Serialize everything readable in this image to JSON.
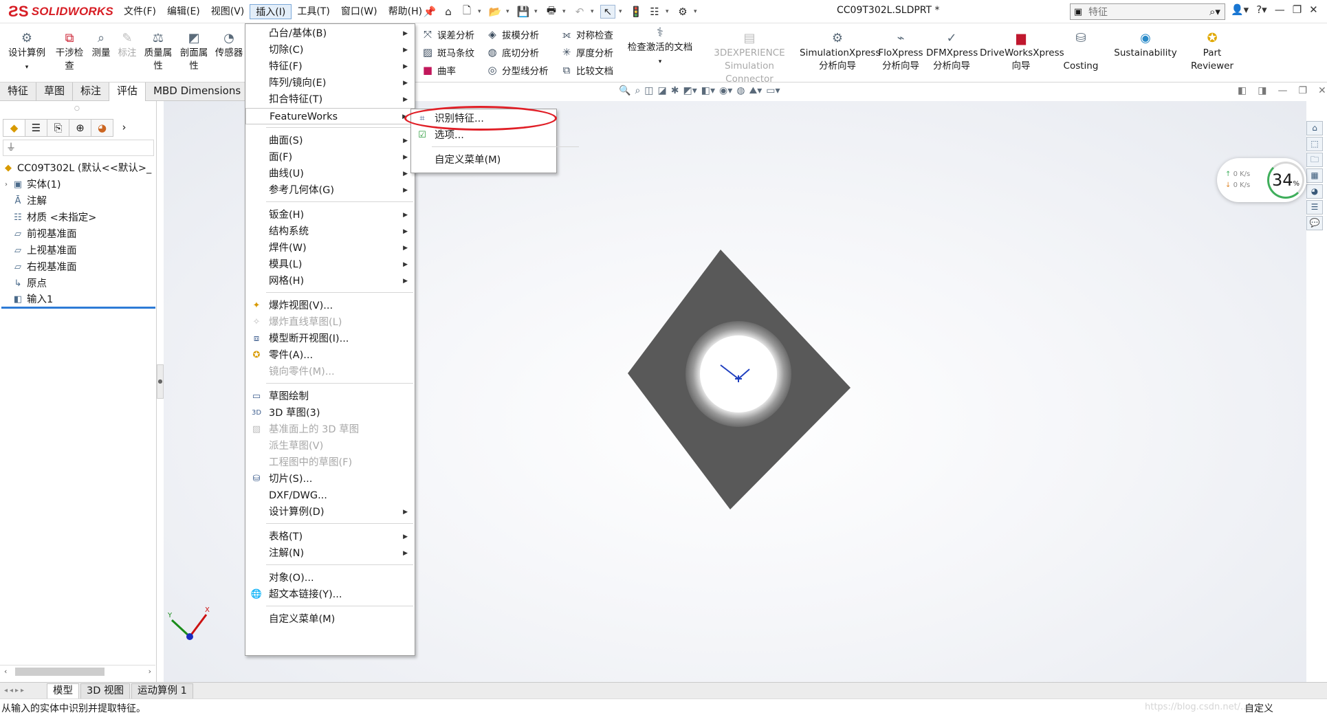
{
  "app": {
    "brand": "SOLIDWORKS",
    "brand_color": "#d71d24",
    "doc_title": "CC09T302L.SLDPRT *"
  },
  "menubar": [
    "文件(F)",
    "编辑(E)",
    "视图(V)",
    "插入(I)",
    "工具(T)",
    "窗口(W)",
    "帮助(H)"
  ],
  "search": {
    "placeholder": "特征"
  },
  "commands": {
    "design_study": "设计算例",
    "interference_a": "干涉检",
    "interference_b": "查",
    "measure": "测量",
    "markup": "标注",
    "mass_a": "质量属",
    "mass_b": "性",
    "section_a": "剖面属",
    "section_b": "性",
    "sensor": "传感器",
    "deviation": "误差分析",
    "zebra": "斑马条纹",
    "curvature": "曲率",
    "draft": "拔模分析",
    "undercut": "底切分析",
    "parting": "分型线分析",
    "symmetry": "对称检查",
    "thickness": "厚度分析",
    "compare": "比较文档",
    "check_active": "检查激活的文档",
    "xp_a": "3DEXPERIENCE",
    "xp_b": "Simulation Connector",
    "simx_a": "SimulationXpress",
    "simx_b": "分析向导",
    "flox_a": "FloXpress",
    "flox_b": "分析向导",
    "dfm_a": "DFMXpress",
    "dfm_b": "分析向导",
    "dw_a": "DriveWorksXpress",
    "dw_b": "向导",
    "costing": "Costing",
    "sustain": "Sustainability",
    "part_a": "Part",
    "part_b": "Reviewer"
  },
  "tabs": [
    "特征",
    "草图",
    "标注",
    "评估",
    "MBD Dimensions"
  ],
  "tree": {
    "root": "CC09T302L  (默认<<默认>_",
    "items": [
      "实体(1)",
      "注解",
      "材质 <未指定>",
      "前视基准面",
      "上视基准面",
      "右视基准面",
      "原点",
      "输入1"
    ]
  },
  "insert_menu": [
    {
      "label": "凸台/基体(B)",
      "sub": true
    },
    {
      "label": "切除(C)",
      "sub": true
    },
    {
      "label": "特征(F)",
      "sub": true
    },
    {
      "label": "阵列/镜向(E)",
      "sub": true
    },
    {
      "label": "扣合特征(T)",
      "sub": true
    },
    {
      "label": "FeatureWorks",
      "sub": true
    },
    {
      "label": "曲面(S)",
      "sub": true
    },
    {
      "label": "面(F)",
      "sub": true
    },
    {
      "label": "曲线(U)",
      "sub": true
    },
    {
      "label": "参考几何体(G)",
      "sub": true
    },
    {
      "label": "钣金(H)",
      "sub": true
    },
    {
      "label": "结构系统",
      "sub": true
    },
    {
      "label": "焊件(W)",
      "sub": true
    },
    {
      "label": "模具(L)",
      "sub": true
    },
    {
      "label": "网格(H)",
      "sub": true
    },
    {
      "label": "爆炸视图(V)..."
    },
    {
      "label": "爆炸直线草图(L)"
    },
    {
      "label": "模型断开视图(I)..."
    },
    {
      "label": "零件(A)..."
    },
    {
      "label": "镜向零件(M)..."
    },
    {
      "label": "草图绘制"
    },
    {
      "label": "3D 草图(3)"
    },
    {
      "label": "基准面上的 3D 草图"
    },
    {
      "label": "派生草图(V)"
    },
    {
      "label": "工程图中的草图(F)"
    },
    {
      "label": "切片(S)..."
    },
    {
      "label": "DXF/DWG..."
    },
    {
      "label": "设计算例(D)",
      "sub": true
    },
    {
      "label": "表格(T)",
      "sub": true
    },
    {
      "label": "注解(N)",
      "sub": true
    },
    {
      "label": "对象(O)..."
    },
    {
      "label": "超文本链接(Y)..."
    },
    {
      "label": "自定义菜单(M)"
    }
  ],
  "featureworks_submenu": [
    "识别特征...",
    "选项...",
    "自定义菜单(M)"
  ],
  "network": {
    "up": "0  K/s",
    "down": "0  K/s",
    "percent": "34",
    "pct_sign": "%"
  },
  "bottom_tabs": [
    "模型",
    "3D 视图",
    "运动算例 1"
  ],
  "status": {
    "message": "从输入的实体中识别并提取特征。",
    "customize": "自定义",
    "watermark": "https://blog.csdn.net/..."
  },
  "colors": {
    "highlight_ring": "#e01e26",
    "model_fill": "#595959",
    "selection_blue": "#2e7bd6"
  }
}
